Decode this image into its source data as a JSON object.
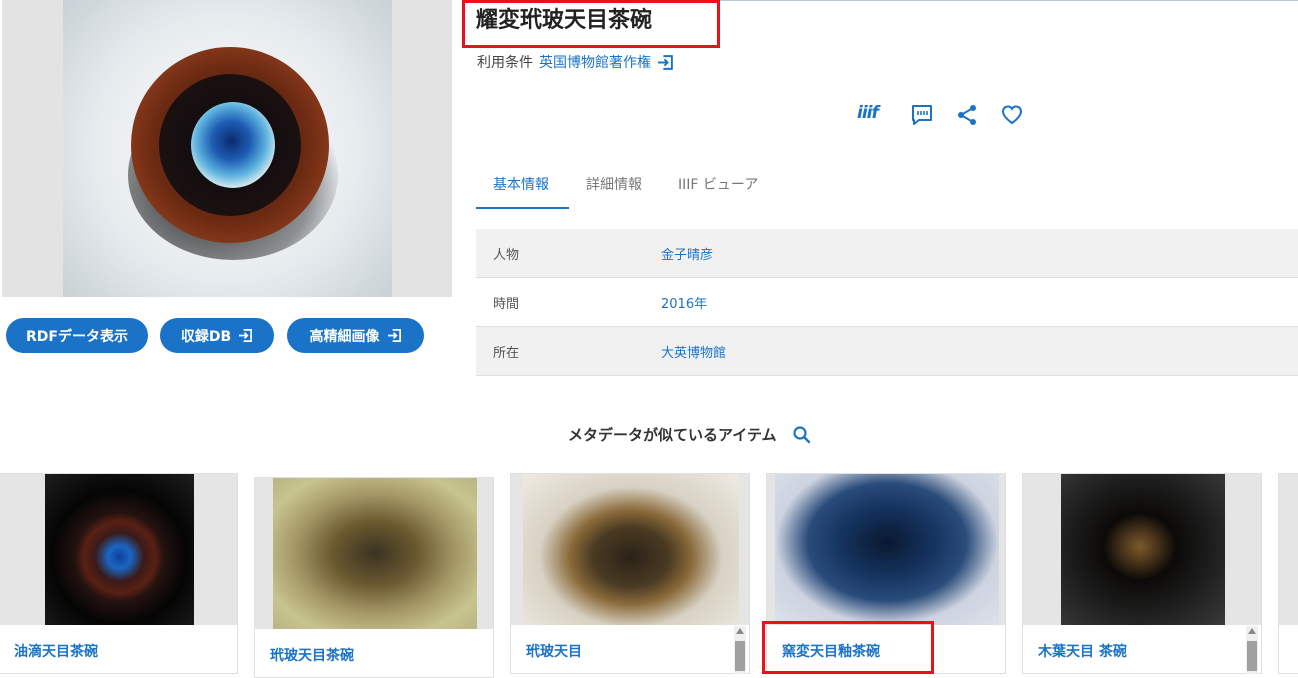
{
  "item": {
    "title": "耀変玳玻天目茶碗",
    "terms_label": "利用条件",
    "terms_link": "英国博物館著作権"
  },
  "buttons": {
    "rdf": "RDFデータ表示",
    "db": "収録DB",
    "hires": "高精細画像"
  },
  "actions": {
    "iiif": "iiif"
  },
  "tabs": [
    "基本情報",
    "詳細情報",
    "IIIF ビューア"
  ],
  "info": [
    {
      "key": "人物",
      "value": "金子晴彦"
    },
    {
      "key": "時間",
      "value": "2016年"
    },
    {
      "key": "所在",
      "value": "大英博物館"
    }
  ],
  "similar": {
    "heading": "メタデータが似ているアイテム",
    "cards": [
      {
        "label": "油滴天目茶碗"
      },
      {
        "label": "玳玻天目茶碗"
      },
      {
        "label": "玳玻天目"
      },
      {
        "label": "窯変天目釉茶碗"
      },
      {
        "label": "木葉天目 茶碗"
      }
    ]
  },
  "colors": {
    "accent": "#1b73c7",
    "highlight": "#e8121b"
  }
}
